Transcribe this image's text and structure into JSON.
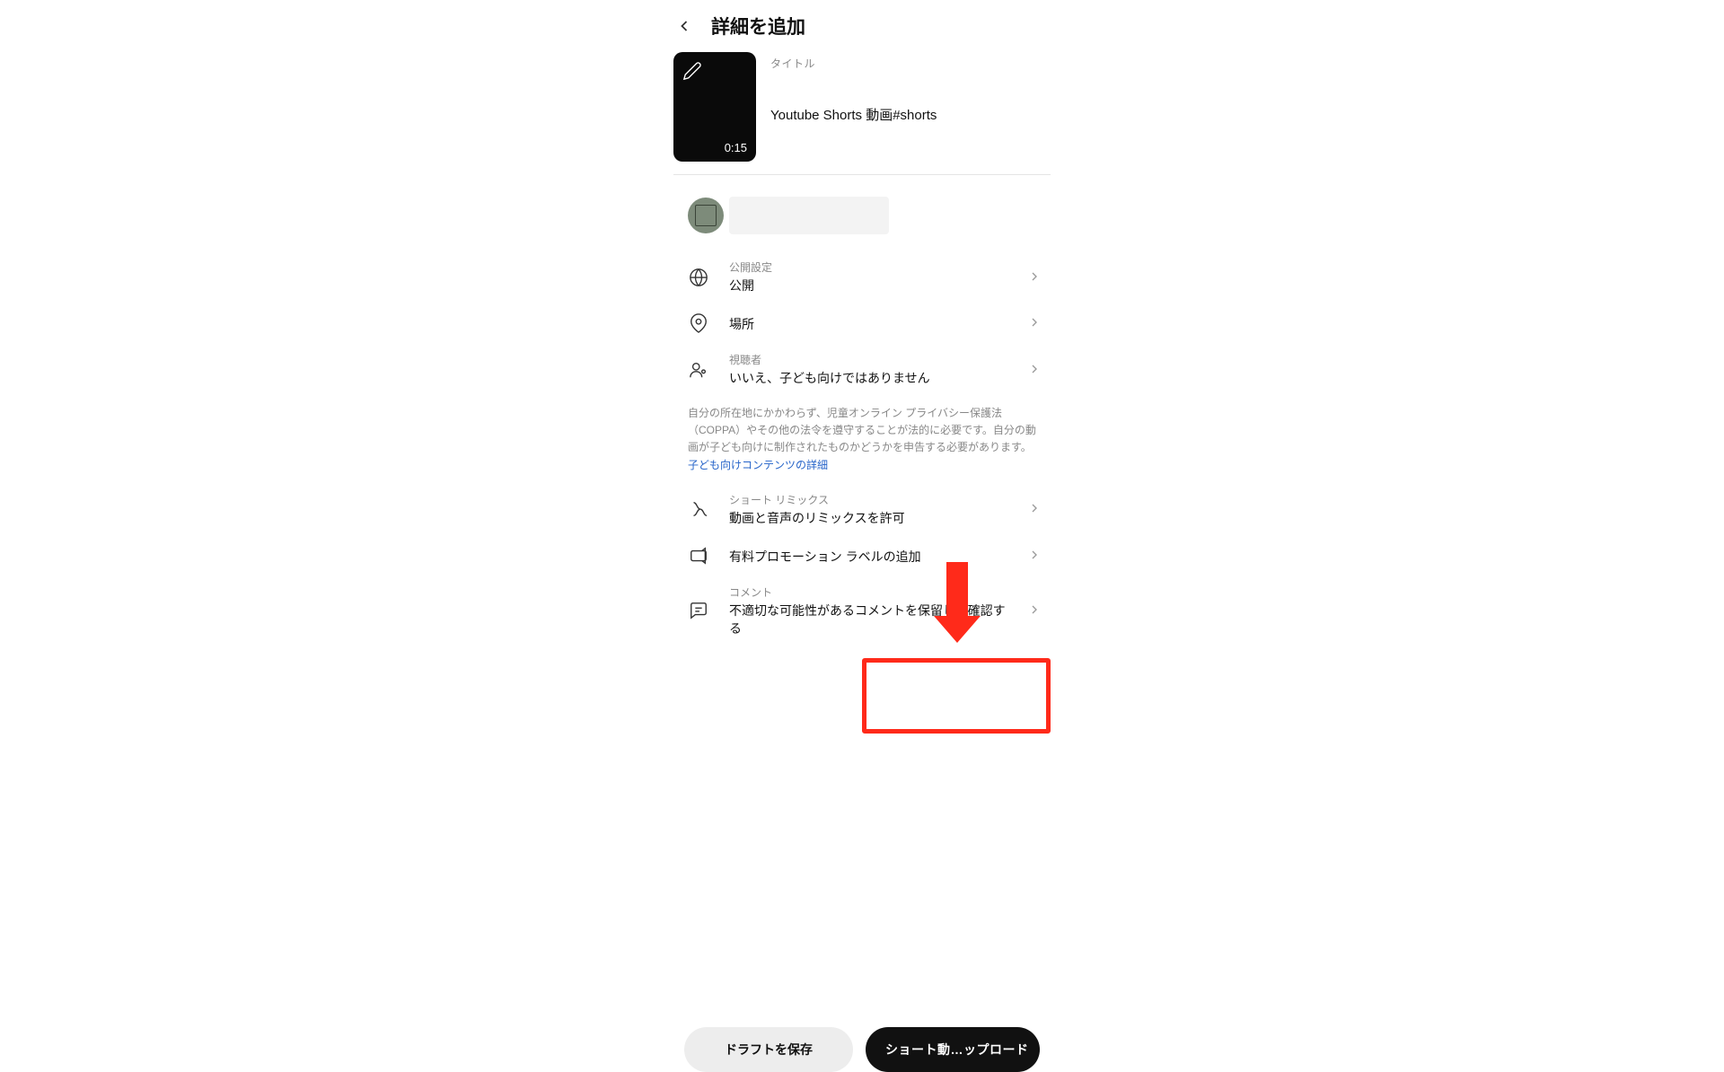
{
  "header": {
    "title": "詳細を追加"
  },
  "video": {
    "titleLabel": "タイトル",
    "title": "Youtube Shorts 動画#shorts",
    "duration": "0:15"
  },
  "settings": {
    "visibility": {
      "label": "公開設定",
      "value": "公開"
    },
    "location": {
      "value": "場所"
    },
    "audience": {
      "label": "視聴者",
      "value": "いいえ、子ども向けではありません"
    },
    "noticeText": "自分の所在地にかかわらず、児童オンライン プライバシー保護法（COPPA）やその他の法令を遵守することが法的に必要です。自分の動画が子ども向けに制作されたものかどうかを申告する必要があります。",
    "noticeLink": "子ども向けコンテンツの詳細",
    "remix": {
      "label": "ショート リミックス",
      "value": "動画と音声のリミックスを許可"
    },
    "paidPromo": {
      "value": "有料プロモーション ラベルの追加"
    },
    "comments": {
      "label": "コメント",
      "value": "不適切な可能性があるコメントを保留して確認する"
    }
  },
  "buttons": {
    "draft": "ドラフトを保存",
    "upload": "ショート動…ップロード"
  }
}
